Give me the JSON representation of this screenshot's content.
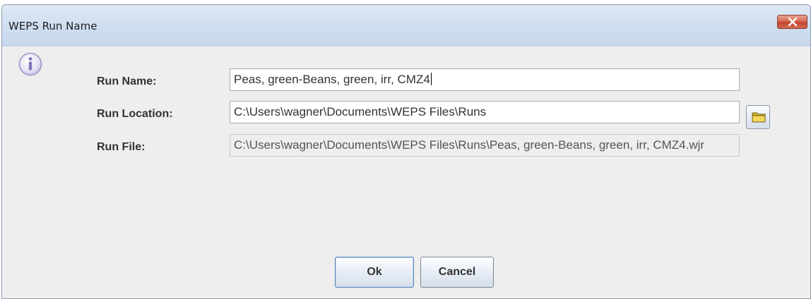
{
  "window": {
    "title": "WEPS Run Name",
    "close_icon": "close-icon"
  },
  "dialog": {
    "icon": "info-icon",
    "run_name": {
      "label": "Run Name:",
      "value": "Peas, green-Beans, green, irr, CMZ4"
    },
    "run_location": {
      "label": "Run Location:",
      "value": "C:\\Users\\wagner\\Documents\\WEPS Files\\Runs",
      "browse_icon": "folder-icon"
    },
    "run_file": {
      "label": "Run File:",
      "value": "C:\\Users\\wagner\\Documents\\WEPS Files\\Runs\\Peas, green-Beans, green, irr, CMZ4.wjr"
    }
  },
  "buttons": {
    "ok_label": "Ok",
    "cancel_label": "Cancel"
  },
  "colors": {
    "title_bar": "#d1dff0",
    "close_button": "#d7624b",
    "dialog_background": "#eeeeee"
  }
}
